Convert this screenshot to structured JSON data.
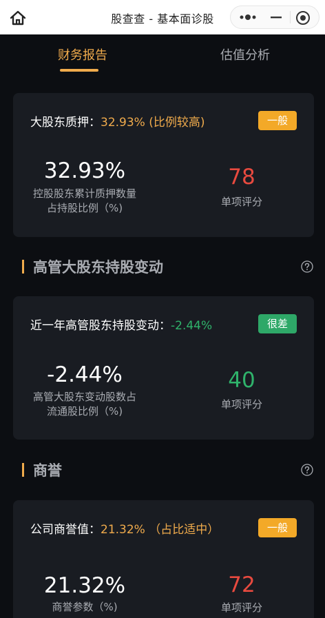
{
  "app": {
    "title": "股查查 - 基本面诊股"
  },
  "tabs": [
    {
      "label": "财务报告",
      "active": true
    },
    {
      "label": "估值分析",
      "active": false
    }
  ],
  "cards": [
    {
      "head_label": "大股东质押：",
      "head_value": "32.93% (比例较高)",
      "badge": "一般",
      "big_value": "32.93%",
      "desc_line1": "控股股东累计质押数量",
      "desc_line2": "占持股比例（%)",
      "score": "78",
      "score_label": "单项评分"
    },
    {
      "head_label": "近一年高管股东持股变动：",
      "head_value": "-2.44%",
      "badge": "很差",
      "big_value": "-2.44%",
      "desc_line1": "高管大股东变动股数占",
      "desc_line2": "流通股比例（%)",
      "score": "40",
      "score_label": "单项评分"
    },
    {
      "head_label": "公司商誉值：",
      "head_value": "21.32% （占比适中）",
      "badge": "一般",
      "big_value": "21.32%",
      "desc_line1": "商誉参数（%)",
      "score": "72",
      "score_label": "单项评分"
    }
  ],
  "sections": [
    {
      "title": "高管大股东持股变动"
    },
    {
      "title": "商誉"
    }
  ],
  "colors": {
    "accent": "#f0ab4c",
    "good": "#2fb36b",
    "bad": "#e84a3f",
    "background": "#0c0e12",
    "card": "#191c22"
  },
  "icons": [
    "home-icon",
    "more-dots-icon",
    "minimize-icon",
    "close-target-icon",
    "help-circle-icon"
  ]
}
